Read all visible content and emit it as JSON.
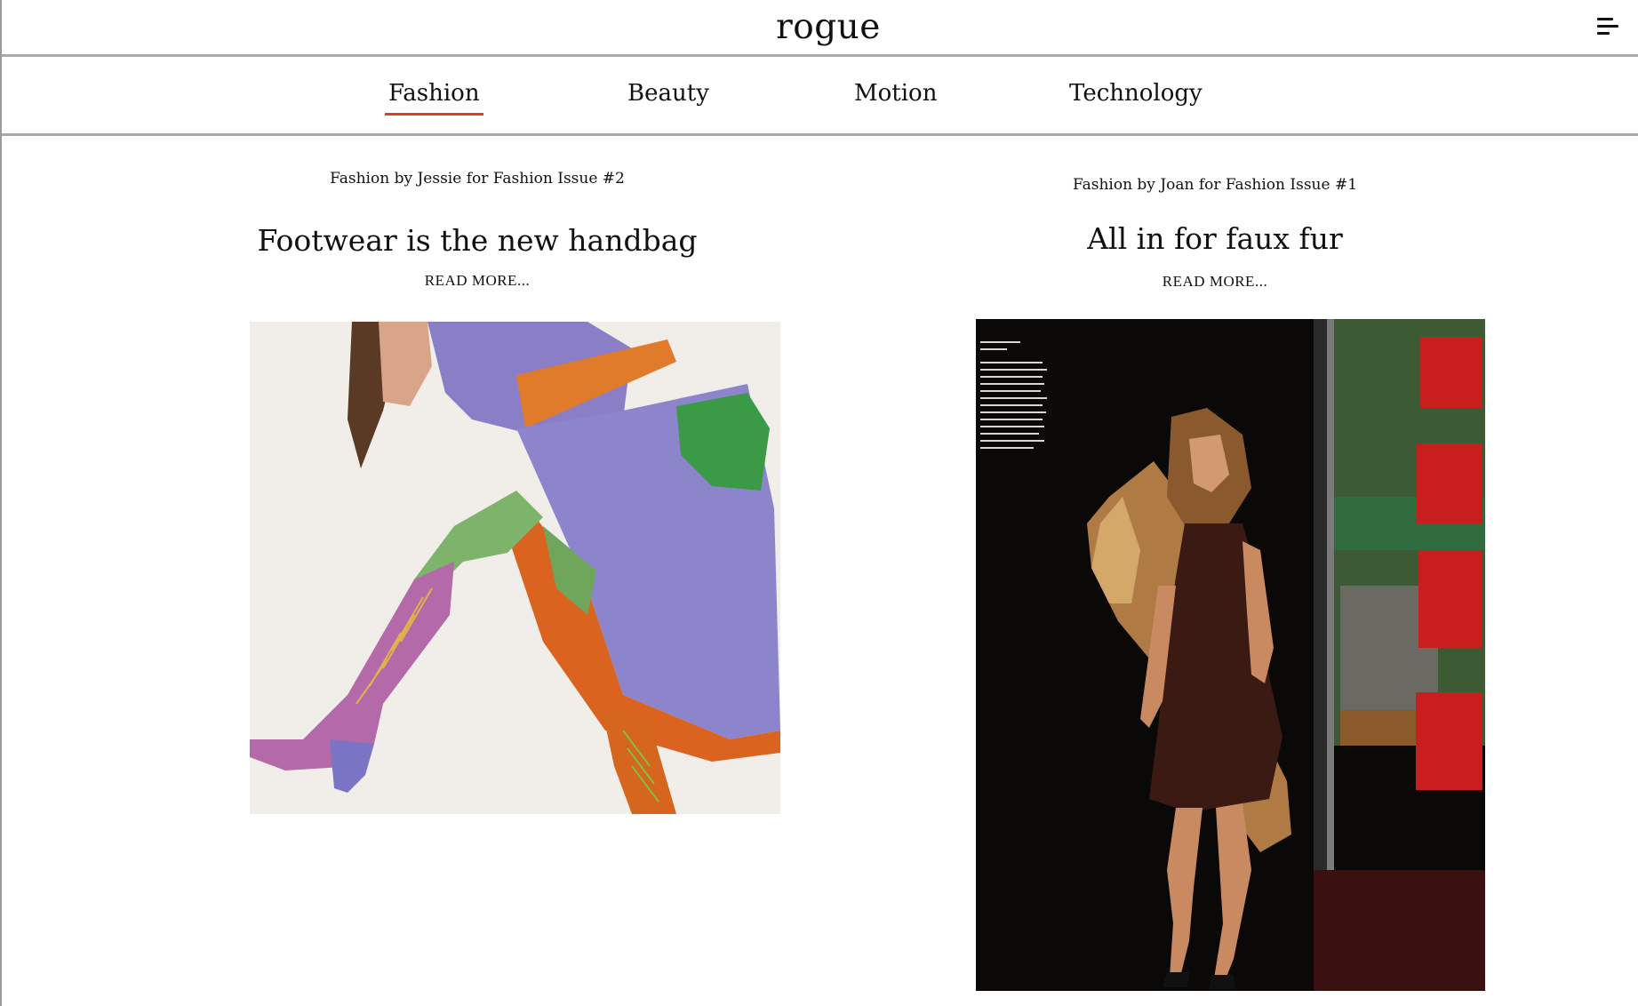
{
  "header": {
    "logo": "rogue",
    "menu_icon": "hamburger-menu-icon"
  },
  "nav": {
    "items": [
      {
        "label": "Fashion",
        "active": true
      },
      {
        "label": "Beauty",
        "active": false
      },
      {
        "label": "Motion",
        "active": false
      },
      {
        "label": "Technology",
        "active": false
      }
    ],
    "active_color": "#e23a25"
  },
  "articles": [
    {
      "byline": "Fashion by Jessie for Fashion Issue #2",
      "title": "Footwear is the new handbag",
      "read_more": "READ MORE...",
      "image": "fashion-photo-lace-up-boots"
    },
    {
      "byline": "Fashion by Joan for Fashion Issue #1",
      "title": "All in for faux fur",
      "read_more": "READ MORE...",
      "image": "fashion-photo-faux-fur-stole"
    }
  ]
}
